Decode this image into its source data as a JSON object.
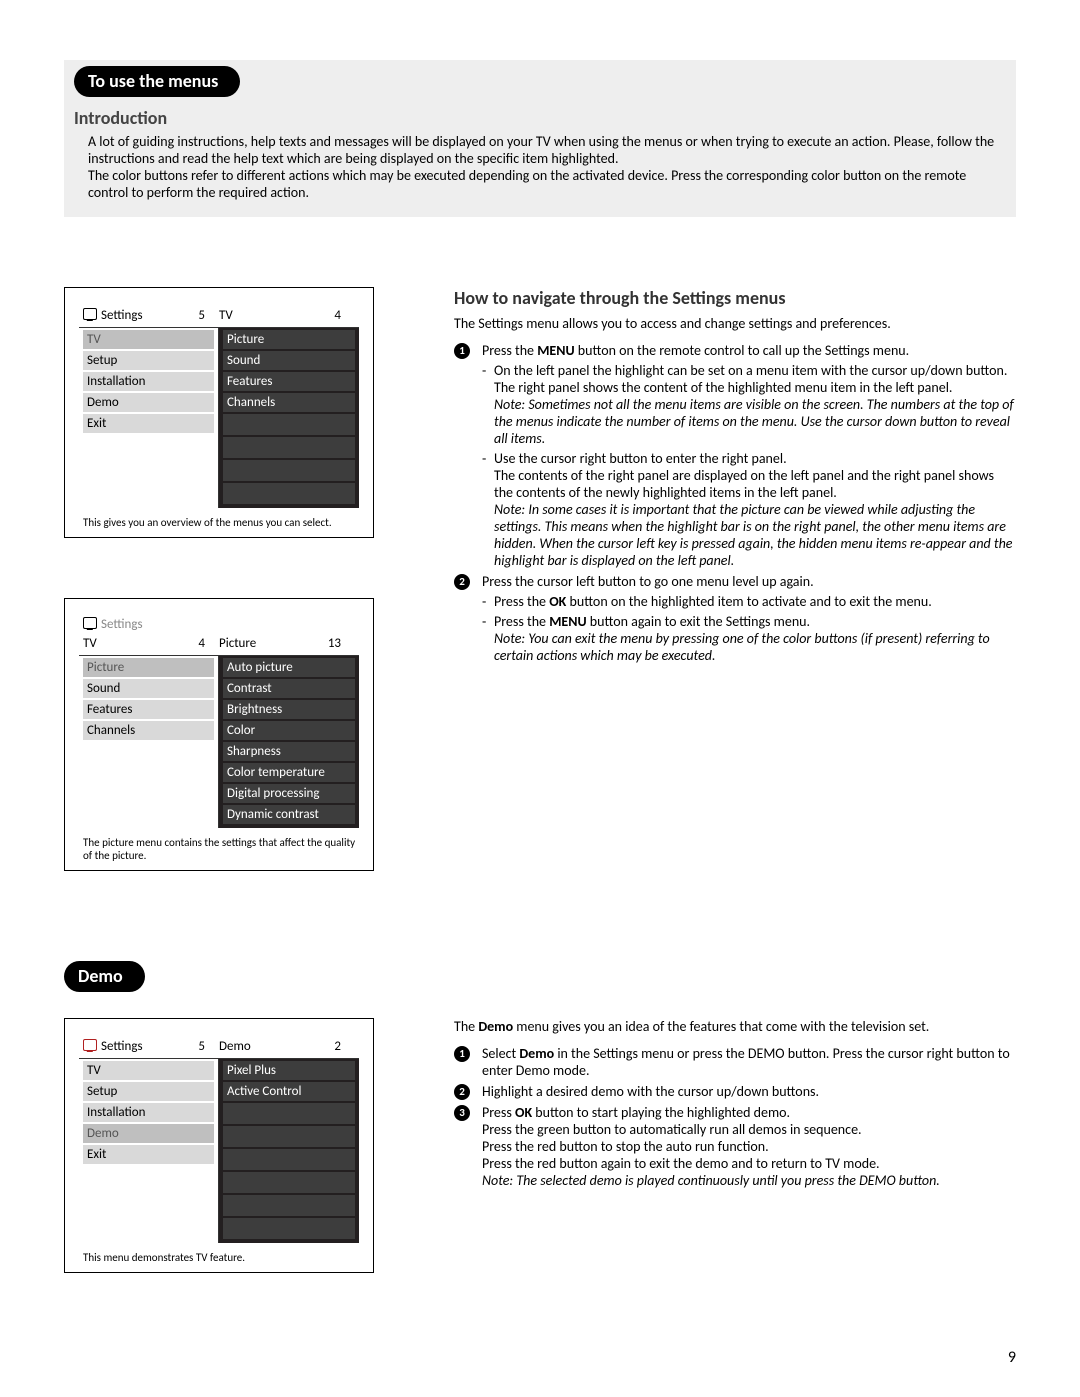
{
  "page_number": "9",
  "section1": {
    "pill": "To use the menus",
    "intro_heading": "Introduction",
    "intro_p1": "A lot of guiding instructions, help texts and messages will be displayed on your TV when using the menus or when trying to execute an action. Please, follow the instructions and read the help text which are being displayed on the specific item highlighted.",
    "intro_p2": "The color buttons refer to different actions which may be executed depending on the activated device. Press the corresponding color button on the remote control to perform the required action."
  },
  "menu1": {
    "left_label": "Settings",
    "left_count": "5",
    "right_label": "TV",
    "right_count": "4",
    "left_items": [
      "TV",
      "Setup",
      "Installation",
      "Demo",
      "Exit"
    ],
    "left_selected": 0,
    "right_items": [
      "Picture",
      "Sound",
      "Features",
      "Channels"
    ],
    "caption": "This gives you an overview of the menus you can select."
  },
  "menu2": {
    "top_label": "Settings",
    "left_label": "TV",
    "left_count": "4",
    "right_label": "Picture",
    "right_count": "13",
    "left_items": [
      "Picture",
      "Sound",
      "Features",
      "Channels"
    ],
    "left_selected": 0,
    "right_items": [
      "Auto picture",
      "Contrast",
      "Brightness",
      "Color",
      "Sharpness",
      "Color temperature",
      "Digital processing",
      "Dynamic contrast"
    ],
    "caption": "The picture menu contains the settings that affect the quality of the picture."
  },
  "howto": {
    "heading": "How to navigate through the Settings menus",
    "lead": "The Settings menu allows you to access and change settings and preferences.",
    "s1a": "Press the ",
    "s1b": "MENU",
    "s1c": " button on the remote control to call up the Settings menu.",
    "d1": "On the left panel the highlight can be set on a menu item with the cursor up/down button.",
    "d1b": "The right panel shows the content of the highlighted menu item in the left panel.",
    "d1note": "Note: Sometimes not all the menu items are visible on the screen. The numbers at the top of the menus indicate the number of items on the menu.  Use the cursor down button to reveal all items.",
    "d2a": "Use the cursor right button to enter the right panel.",
    "d2b": "The contents of the right panel are displayed on the left panel and the right panel shows the contents of the newly highlighted items in the left panel.",
    "d2note": "Note: In some cases it is important that the picture can be viewed while adjusting the settings. This means when the highlight bar is on the right panel, the other menu items are hidden.  When the cursor left key is pressed again, the hidden menu items re-appear and the highlight bar is displayed on the left panel.",
    "s2": "Press the cursor left button to go one menu level up again.",
    "s2d1a": "Press the ",
    "s2d1b": "OK",
    "s2d1c": " button on the highlighted item to activate and to exit the menu.",
    "s2d2a": "Press the ",
    "s2d2b": "MENU",
    "s2d2c": " button again to exit the Settings menu.",
    "s2note": "Note: You can exit the menu by pressing one of the color buttons (if present) referring to certain actions which may be executed."
  },
  "section2": {
    "pill": "Demo"
  },
  "menu3": {
    "left_label": "Settings",
    "left_count": "5",
    "right_label": "Demo",
    "right_count": "2",
    "left_items": [
      "TV",
      "Setup",
      "Installation",
      "Demo",
      "Exit"
    ],
    "left_selected": 3,
    "right_items": [
      "Pixel Plus",
      "Active Control"
    ],
    "caption": "This menu demonstrates TV feature."
  },
  "demo": {
    "lead_a": "The ",
    "lead_b": "Demo",
    "lead_c": " menu gives you an idea of the features that come with the television set.",
    "s1a": "Select ",
    "s1b": "Demo",
    "s1c": " in the Settings menu or press the DEMO button.  Press the cursor right button to enter Demo mode.",
    "s2": "Highlight a desired demo with the cursor up/down buttons.",
    "s3a": "Press ",
    "s3b": "OK",
    "s3c": " button to start playing the highlighted demo.",
    "s3l1": "Press the green button to automatically run all demos in sequence.",
    "s3l2": "Press the red button to stop the auto run function.",
    "s3l3": "Press the red button again to exit the demo and to return to TV mode.",
    "s3note": "Note: The selected demo is played continuously until you press the DEMO button."
  }
}
